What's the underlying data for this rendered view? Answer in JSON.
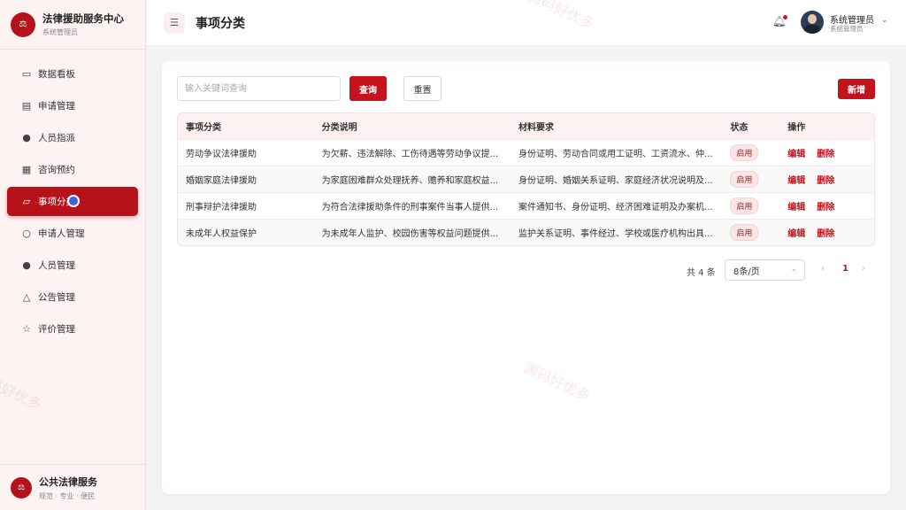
{
  "brand": {
    "logo_glyph": "⚖",
    "title": "法律援助服务中心",
    "subtitle": "系统管理员"
  },
  "sidebar": {
    "items": [
      {
        "label": "数据看板",
        "icon": "monitor-icon"
      },
      {
        "label": "申请管理",
        "icon": "document-icon"
      },
      {
        "label": "人员指派",
        "icon": "user-icon"
      },
      {
        "label": "咨询预约",
        "icon": "calendar-icon"
      },
      {
        "label": "事项分类",
        "icon": "folder-icon",
        "active": true
      },
      {
        "label": "申请人管理",
        "icon": "person-outline-icon"
      },
      {
        "label": "人员管理",
        "icon": "user-icon"
      },
      {
        "label": "公告管理",
        "icon": "bell-icon"
      },
      {
        "label": "评价管理",
        "icon": "star-icon"
      }
    ],
    "footer": {
      "logo_glyph": "⚖",
      "title": "公共法律服务",
      "subtitle": "规范 · 专业 · 便民"
    }
  },
  "header": {
    "title": "事项分类",
    "user": {
      "name": "系统管理员",
      "role": "系统管理员"
    }
  },
  "toolbar": {
    "search_placeholder": "输入关键词查询",
    "query_label": "查询",
    "reset_label": "重置",
    "add_label": "新增"
  },
  "table": {
    "headers": [
      "事项分类",
      "分类说明",
      "材料要求",
      "状态",
      "操作"
    ],
    "rows": [
      {
        "category": "劳动争议法律援助",
        "desc": "为欠薪、违法解除、工伤待遇等劳动争议提...",
        "materials": "身份证明、劳动合同或用工证明、工资流水、仲...",
        "status": "启用",
        "edit": "编辑",
        "delete": "删除"
      },
      {
        "category": "婚姻家庭法律援助",
        "desc": "为家庭困难群众处理抚养、赡养和家庭权益...",
        "materials": "身份证明、婚姻关系证明、家庭经济状况说明及...",
        "status": "启用",
        "edit": "编辑",
        "delete": "删除"
      },
      {
        "category": "刑事辩护法律援助",
        "desc": "为符合法律援助条件的刑事案件当事人提供...",
        "materials": "案件通知书、身份证明、经济困难证明及办案机...",
        "status": "启用",
        "edit": "编辑",
        "delete": "删除"
      },
      {
        "category": "未成年人权益保护",
        "desc": "为未成年人监护、校园伤害等权益问题提供...",
        "materials": "监护关系证明、事件经过、学校或医疗机构出具...",
        "status": "启用",
        "edit": "编辑",
        "delete": "删除"
      }
    ]
  },
  "pagination": {
    "total": "共 4 条",
    "page_size": "8条/页",
    "current_page": "1",
    "prev": "‹",
    "next": "›"
  },
  "watermark": "源码好优多",
  "colors": {
    "primary": "#c3141d",
    "sidebar_bg": "#fdf3f3",
    "active_bg": "#b5121b"
  }
}
